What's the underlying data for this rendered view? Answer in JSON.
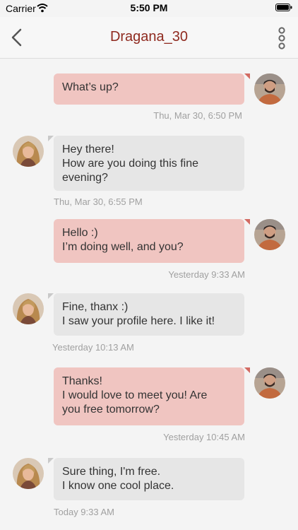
{
  "status_bar": {
    "carrier": "Carrier",
    "time": "5:50 PM"
  },
  "nav": {
    "title": "Dragana_30"
  },
  "messages": [
    {
      "direction": "out",
      "lines": [
        "What’s up?"
      ],
      "time": "Thu, Mar 30, 6:50 PM"
    },
    {
      "direction": "in",
      "lines": [
        "Hey there!",
        "How are you doing this fine",
        "evening?"
      ],
      "time": "Thu, Mar 30, 6:55 PM"
    },
    {
      "direction": "out",
      "lines": [
        "Hello :)",
        "I’m doing well, and you?"
      ],
      "time": "Yesterday 9:33 AM"
    },
    {
      "direction": "in",
      "lines": [
        "Fine, thanx :)",
        "I saw your profile here. I like it!"
      ],
      "time": "Yesterday 10:13 AM"
    },
    {
      "direction": "out",
      "lines": [
        "Thanks!",
        "I would love to meet you! Are",
        "you free tomorrow?"
      ],
      "time": "Yesterday 10:45 AM"
    },
    {
      "direction": "in",
      "lines": [
        "Sure thing, I'm free.",
        "I know one cool place."
      ],
      "time": "Today 9:33 AM"
    }
  ],
  "colors": {
    "accent": "#8f2a1f",
    "outgoing": "#f0c5c1",
    "incoming": "#e6e6e6"
  }
}
